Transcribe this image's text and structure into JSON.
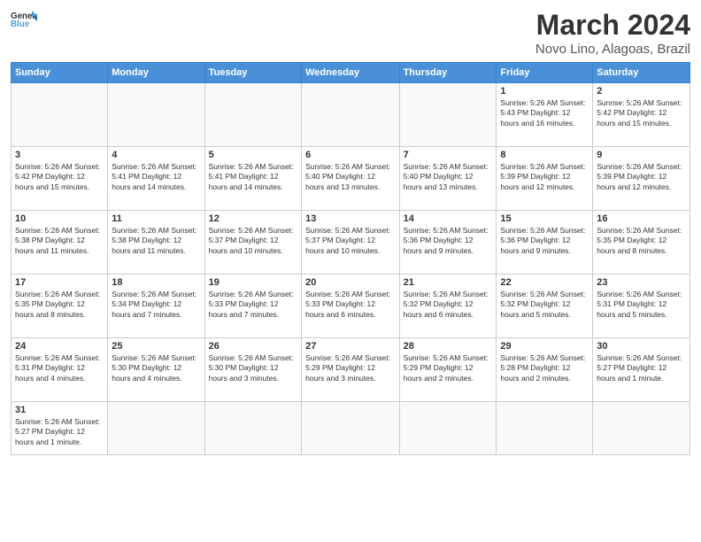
{
  "header": {
    "logo_general": "General",
    "logo_blue": "Blue",
    "title": "March 2024",
    "subtitle": "Novo Lino, Alagoas, Brazil"
  },
  "days_of_week": [
    "Sunday",
    "Monday",
    "Tuesday",
    "Wednesday",
    "Thursday",
    "Friday",
    "Saturday"
  ],
  "weeks": [
    [
      {
        "day": "",
        "info": ""
      },
      {
        "day": "",
        "info": ""
      },
      {
        "day": "",
        "info": ""
      },
      {
        "day": "",
        "info": ""
      },
      {
        "day": "",
        "info": ""
      },
      {
        "day": "1",
        "info": "Sunrise: 5:26 AM\nSunset: 5:43 PM\nDaylight: 12 hours and 16 minutes."
      },
      {
        "day": "2",
        "info": "Sunrise: 5:26 AM\nSunset: 5:42 PM\nDaylight: 12 hours and 15 minutes."
      }
    ],
    [
      {
        "day": "3",
        "info": "Sunrise: 5:26 AM\nSunset: 5:42 PM\nDaylight: 12 hours and 15 minutes."
      },
      {
        "day": "4",
        "info": "Sunrise: 5:26 AM\nSunset: 5:41 PM\nDaylight: 12 hours and 14 minutes."
      },
      {
        "day": "5",
        "info": "Sunrise: 5:26 AM\nSunset: 5:41 PM\nDaylight: 12 hours and 14 minutes."
      },
      {
        "day": "6",
        "info": "Sunrise: 5:26 AM\nSunset: 5:40 PM\nDaylight: 12 hours and 13 minutes."
      },
      {
        "day": "7",
        "info": "Sunrise: 5:26 AM\nSunset: 5:40 PM\nDaylight: 12 hours and 13 minutes."
      },
      {
        "day": "8",
        "info": "Sunrise: 5:26 AM\nSunset: 5:39 PM\nDaylight: 12 hours and 12 minutes."
      },
      {
        "day": "9",
        "info": "Sunrise: 5:26 AM\nSunset: 5:39 PM\nDaylight: 12 hours and 12 minutes."
      }
    ],
    [
      {
        "day": "10",
        "info": "Sunrise: 5:26 AM\nSunset: 5:38 PM\nDaylight: 12 hours and 11 minutes."
      },
      {
        "day": "11",
        "info": "Sunrise: 5:26 AM\nSunset: 5:38 PM\nDaylight: 12 hours and 11 minutes."
      },
      {
        "day": "12",
        "info": "Sunrise: 5:26 AM\nSunset: 5:37 PM\nDaylight: 12 hours and 10 minutes."
      },
      {
        "day": "13",
        "info": "Sunrise: 5:26 AM\nSunset: 5:37 PM\nDaylight: 12 hours and 10 minutes."
      },
      {
        "day": "14",
        "info": "Sunrise: 5:26 AM\nSunset: 5:36 PM\nDaylight: 12 hours and 9 minutes."
      },
      {
        "day": "15",
        "info": "Sunrise: 5:26 AM\nSunset: 5:36 PM\nDaylight: 12 hours and 9 minutes."
      },
      {
        "day": "16",
        "info": "Sunrise: 5:26 AM\nSunset: 5:35 PM\nDaylight: 12 hours and 8 minutes."
      }
    ],
    [
      {
        "day": "17",
        "info": "Sunrise: 5:26 AM\nSunset: 5:35 PM\nDaylight: 12 hours and 8 minutes."
      },
      {
        "day": "18",
        "info": "Sunrise: 5:26 AM\nSunset: 5:34 PM\nDaylight: 12 hours and 7 minutes."
      },
      {
        "day": "19",
        "info": "Sunrise: 5:26 AM\nSunset: 5:33 PM\nDaylight: 12 hours and 7 minutes."
      },
      {
        "day": "20",
        "info": "Sunrise: 5:26 AM\nSunset: 5:33 PM\nDaylight: 12 hours and 6 minutes."
      },
      {
        "day": "21",
        "info": "Sunrise: 5:26 AM\nSunset: 5:32 PM\nDaylight: 12 hours and 6 minutes."
      },
      {
        "day": "22",
        "info": "Sunrise: 5:26 AM\nSunset: 5:32 PM\nDaylight: 12 hours and 5 minutes."
      },
      {
        "day": "23",
        "info": "Sunrise: 5:26 AM\nSunset: 5:31 PM\nDaylight: 12 hours and 5 minutes."
      }
    ],
    [
      {
        "day": "24",
        "info": "Sunrise: 5:26 AM\nSunset: 5:31 PM\nDaylight: 12 hours and 4 minutes."
      },
      {
        "day": "25",
        "info": "Sunrise: 5:26 AM\nSunset: 5:30 PM\nDaylight: 12 hours and 4 minutes."
      },
      {
        "day": "26",
        "info": "Sunrise: 5:26 AM\nSunset: 5:30 PM\nDaylight: 12 hours and 3 minutes."
      },
      {
        "day": "27",
        "info": "Sunrise: 5:26 AM\nSunset: 5:29 PM\nDaylight: 12 hours and 3 minutes."
      },
      {
        "day": "28",
        "info": "Sunrise: 5:26 AM\nSunset: 5:29 PM\nDaylight: 12 hours and 2 minutes."
      },
      {
        "day": "29",
        "info": "Sunrise: 5:26 AM\nSunset: 5:28 PM\nDaylight: 12 hours and 2 minutes."
      },
      {
        "day": "30",
        "info": "Sunrise: 5:26 AM\nSunset: 5:27 PM\nDaylight: 12 hours and 1 minute."
      }
    ],
    [
      {
        "day": "31",
        "info": "Sunrise: 5:26 AM\nSunset: 5:27 PM\nDaylight: 12 hours and 1 minute."
      },
      {
        "day": "",
        "info": ""
      },
      {
        "day": "",
        "info": ""
      },
      {
        "day": "",
        "info": ""
      },
      {
        "day": "",
        "info": ""
      },
      {
        "day": "",
        "info": ""
      },
      {
        "day": "",
        "info": ""
      }
    ]
  ]
}
